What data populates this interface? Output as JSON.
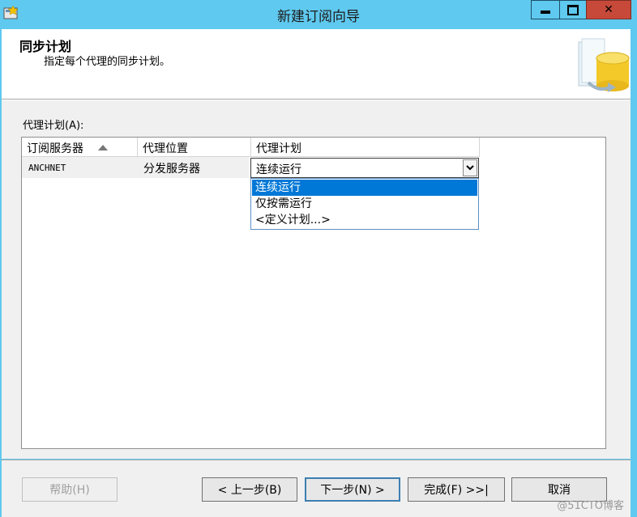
{
  "window": {
    "title": "新建订阅向导",
    "close_glyph": "✕",
    "accent_color": "#5fc9ef"
  },
  "header": {
    "title": "同步计划",
    "subtitle": "指定每个代理的同步计划。"
  },
  "agent_schedule_label": "代理计划(A):",
  "grid": {
    "columns": [
      "订阅服务器",
      "代理位置",
      "代理计划"
    ],
    "rows": [
      {
        "subscriber": "ANCHNET",
        "agent_location": "分发服务器",
        "agent_schedule": "连续运行"
      }
    ]
  },
  "dropdown": {
    "options": [
      "连续运行",
      "仅按需运行",
      "<定义计划...>"
    ],
    "selected_color": "#0078d7"
  },
  "footer": {
    "help": "帮助(H)",
    "back": "< 上一步(B)",
    "next": "下一步(N) >",
    "finish": "完成(F) >>|",
    "cancel": "取消"
  },
  "watermark": "@51CTO博客"
}
